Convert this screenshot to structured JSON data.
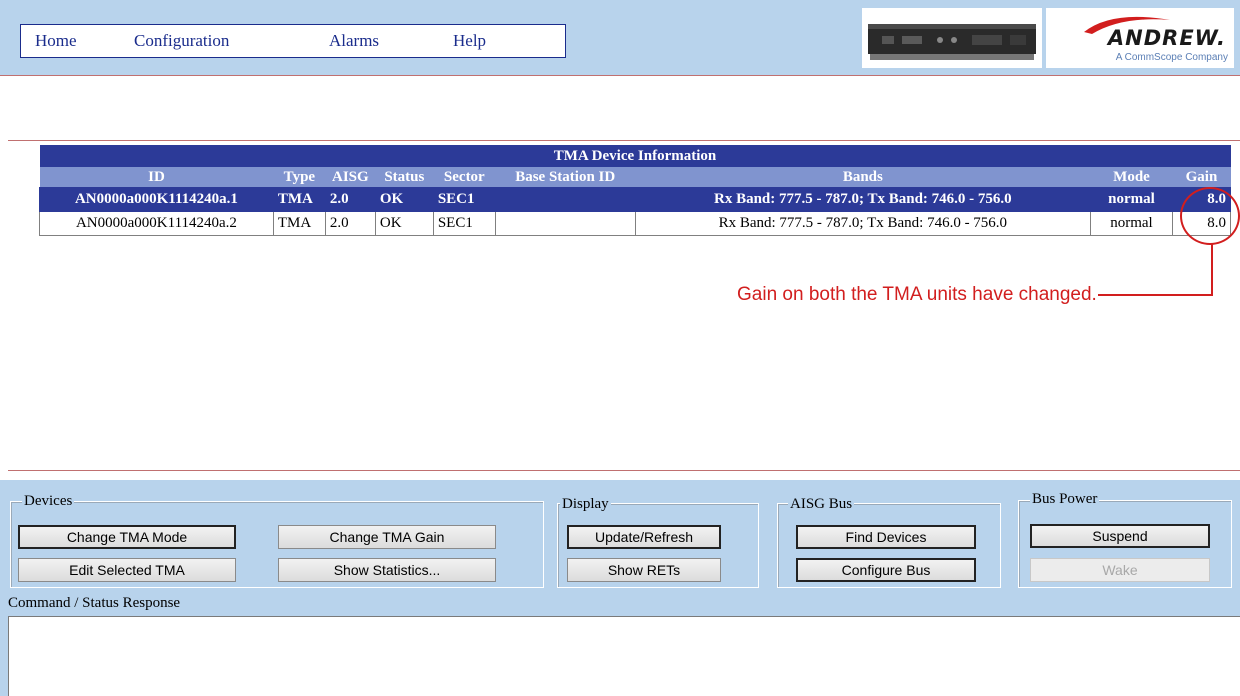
{
  "nav": {
    "items": [
      "Home",
      "Configuration",
      "Alarms",
      "Help"
    ]
  },
  "logo": {
    "name": "ANDREW.",
    "tagline": "A CommScope Company"
  },
  "table": {
    "title": "TMA Device Information",
    "columns": [
      "ID",
      "Type",
      "AISG",
      "Status",
      "Sector",
      "Base Station ID",
      "Bands",
      "Mode",
      "Gain"
    ],
    "rows": [
      {
        "id": "AN0000a000K1114240a.1",
        "type": "TMA",
        "aisg": "2.0",
        "status": "OK",
        "sector": "SEC1",
        "base_station_id": "",
        "bands": "Rx Band: 777.5 - 787.0; Tx Band: 746.0 - 756.0",
        "mode": "normal",
        "gain": "8.0",
        "selected": true
      },
      {
        "id": "AN0000a000K1114240a.2",
        "type": "TMA",
        "aisg": "2.0",
        "status": "OK",
        "sector": "SEC1",
        "base_station_id": "",
        "bands": "Rx Band: 777.5 - 787.0; Tx Band: 746.0 - 756.0",
        "mode": "normal",
        "gain": "8.0",
        "selected": false
      }
    ]
  },
  "annotation": {
    "text": "Gain on both the TMA units have changed."
  },
  "panel": {
    "devices": {
      "label": "Devices",
      "change_mode": "Change TMA Mode",
      "change_gain": "Change TMA Gain",
      "edit_selected": "Edit Selected TMA",
      "show_statistics": "Show Statistics..."
    },
    "display": {
      "label": "Display",
      "update_refresh": "Update/Refresh",
      "show_rets": "Show RETs"
    },
    "aisg_bus": {
      "label": "AISG Bus",
      "find_devices": "Find Devices",
      "configure_bus": "Configure Bus"
    },
    "bus_power": {
      "label": "Bus Power",
      "suspend": "Suspend",
      "wake": "Wake"
    },
    "status_label": "Command / Status Response"
  },
  "colors": {
    "header_blue": "#2c3a98",
    "header_light": "#8094cf",
    "panel_bg": "#b8d3ec",
    "annotation_red": "#d21e1e"
  }
}
